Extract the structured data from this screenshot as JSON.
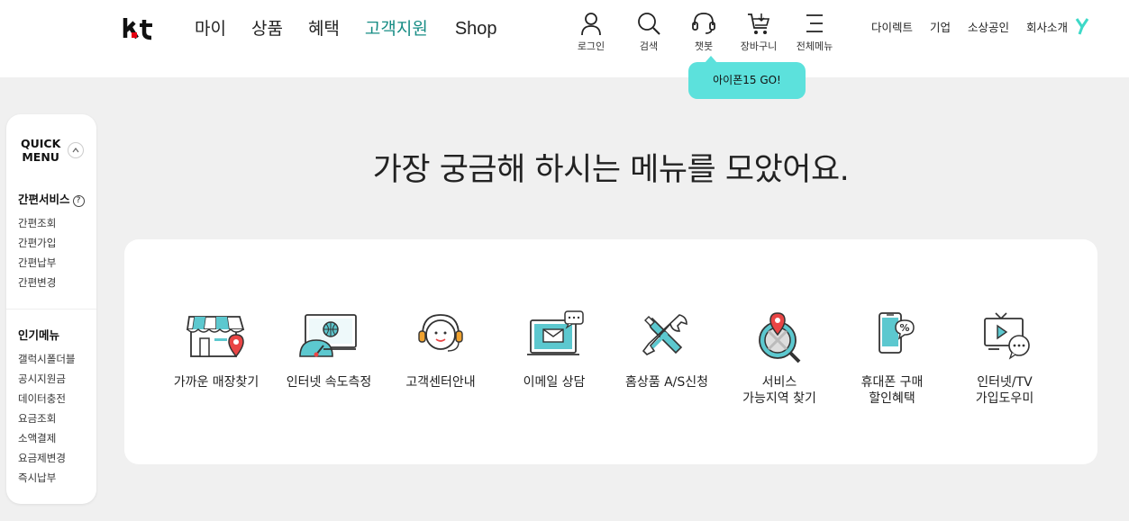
{
  "header": {
    "logo": "kt",
    "nav": [
      "마이",
      "상품",
      "혜택",
      "고객지원",
      "Shop"
    ],
    "utils": [
      {
        "label": "로그인",
        "icon": "person-icon"
      },
      {
        "label": "검색",
        "icon": "search-icon"
      },
      {
        "label": "챗봇",
        "icon": "headset-icon"
      },
      {
        "label": "장바구니",
        "icon": "cart-icon"
      },
      {
        "label": "전체메뉴",
        "icon": "menu-icon"
      }
    ],
    "links": [
      "다이렉트",
      "기업",
      "소상공인",
      "회사소개"
    ]
  },
  "tooltip": "아이폰15 GO!",
  "quick": {
    "title": "QUICK\nMENU",
    "section1": "간편서비스",
    "section1_items": [
      "간편조회",
      "간편가입",
      "간편납부",
      "간편변경"
    ],
    "section2": "인기메뉴",
    "section2_items": [
      "갤럭시폴더블",
      "공시지원금",
      "데이터충전",
      "요금조회",
      "소액결제",
      "요금제변경",
      "즉시납부"
    ]
  },
  "headline": "가장 궁금해 하시는 메뉴를 모았어요.",
  "services": [
    {
      "label": "가까운 매장찾기",
      "icon": "store-icon"
    },
    {
      "label": "인터넷 속도측정",
      "icon": "speed-test-icon"
    },
    {
      "label": "고객센터안내",
      "icon": "support-agent-icon"
    },
    {
      "label": "이메일 상담",
      "icon": "email-icon"
    },
    {
      "label": "홈상품 A/S신청",
      "icon": "tools-icon"
    },
    {
      "label": "서비스\n가능지역 찾기",
      "icon": "area-search-icon"
    },
    {
      "label": "휴대폰 구매\n할인혜택",
      "icon": "phone-discount-icon"
    },
    {
      "label": "인터넷/TV\n가입도우미",
      "icon": "tv-help-icon"
    }
  ],
  "colors": {
    "accent": "#168c84",
    "tooltip": "#5ce1dc",
    "icon_teal": "#5cc8cf",
    "icon_red": "#e94545"
  }
}
